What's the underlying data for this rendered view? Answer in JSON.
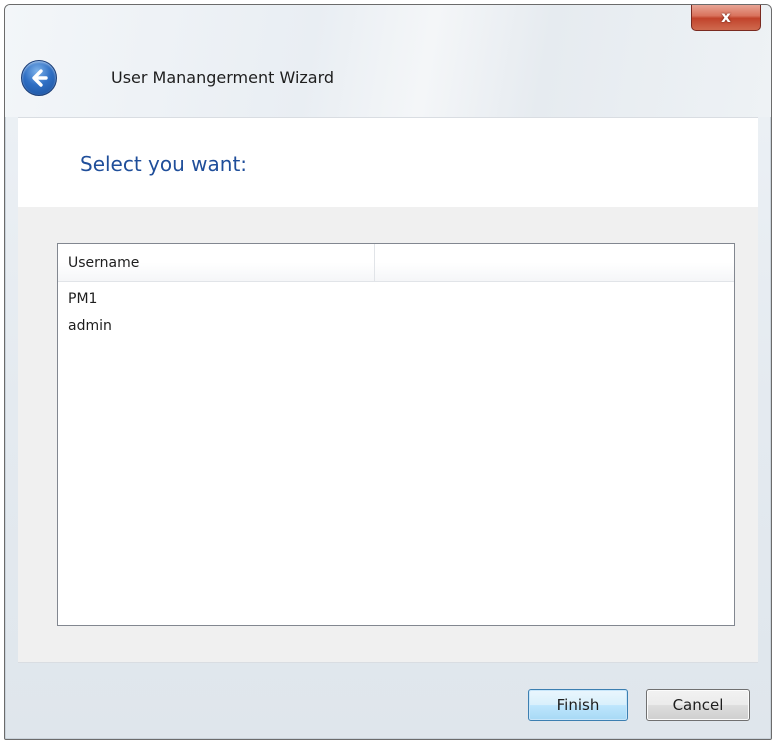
{
  "window": {
    "title": "User Manangerment Wizard",
    "close_glyph": "x"
  },
  "page": {
    "instruction": "Select you want:"
  },
  "list": {
    "columns": [
      "Username",
      ""
    ],
    "rows": [
      "PM1",
      "admin"
    ]
  },
  "buttons": {
    "finish_label": "Finish",
    "cancel_label": "Cancel"
  },
  "icons": {
    "back": "back-arrow-icon",
    "close": "close-icon"
  },
  "colors": {
    "instruction_text": "#1f4e9a",
    "close_button": "#c1432b",
    "back_button": "#2f6fc4",
    "finish_button_border": "#3c7fb1"
  }
}
